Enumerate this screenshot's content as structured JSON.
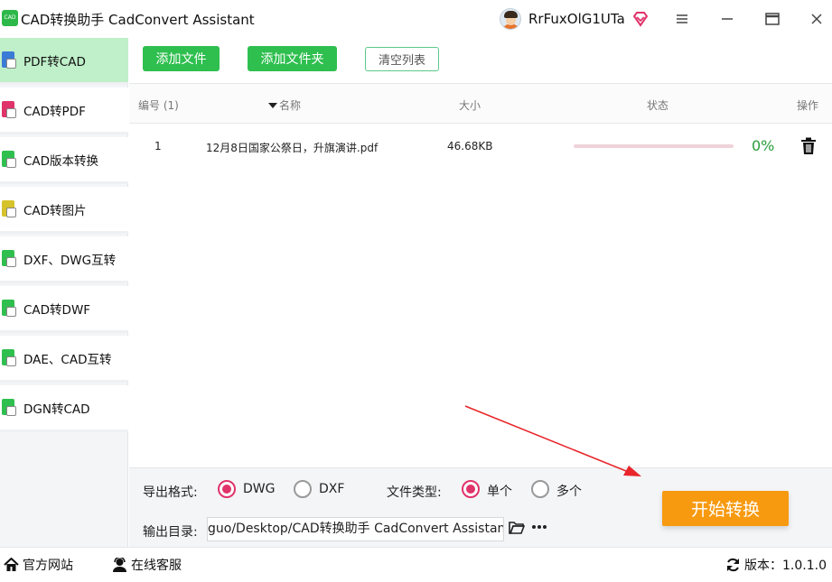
{
  "app": {
    "logo_text": "CAD",
    "title": "CAD转换助手 CadConvert Assistant",
    "username": "RrFuxOlG1UTa",
    "window_buttons": [
      "menu-icon",
      "minimize-icon",
      "maximize-icon",
      "close-icon"
    ]
  },
  "sidebar": {
    "items": [
      {
        "label": "PDF转CAD",
        "active": true,
        "icon": "pdf-to-cad-icon"
      },
      {
        "label": "CAD转PDF",
        "active": false,
        "icon": "cad-to-pdf-icon"
      },
      {
        "label": "CAD版本转换",
        "active": false,
        "icon": "cad-version-icon"
      },
      {
        "label": "CAD转图片",
        "active": false,
        "icon": "cad-to-image-icon"
      },
      {
        "label": "DXF、DWG互转",
        "active": false,
        "icon": "dxf-dwg-icon"
      },
      {
        "label": "CAD转DWF",
        "active": false,
        "icon": "cad-to-dwf-icon"
      },
      {
        "label": "DAE、CAD互转",
        "active": false,
        "icon": "dae-cad-icon"
      },
      {
        "label": "DGN转CAD",
        "active": false,
        "icon": "dgn-to-cad-icon"
      }
    ]
  },
  "toolbar": {
    "add_file": "添加文件",
    "add_folder": "添加文件夹",
    "clear_list": "清空列表"
  },
  "table": {
    "headers": {
      "index": "编号 (1)",
      "name": "名称",
      "size": "大小",
      "status": "状态",
      "action": "操作"
    },
    "rows": [
      {
        "index": "1",
        "name": "12月8日国家公祭日，升旗演讲.pdf",
        "size": "46.68KB",
        "progress": 0,
        "percent": "0%"
      }
    ]
  },
  "options": {
    "format_label": "导出格式:",
    "format_dwg": "DWG",
    "format_dxf": "DXF",
    "format_selected": "DWG",
    "type_label": "文件类型:",
    "type_single": "单个",
    "type_multi": "多个",
    "type_selected": "单个",
    "output_label": "输出目录:",
    "output_path": "guo/Desktop/CAD转换助手 CadConvert Assistant",
    "start_button": "开始转换"
  },
  "statusbar": {
    "website": "官方网站",
    "support": "在线客服",
    "version": "版本：1.0.1.0"
  },
  "colors": {
    "accent_green": "#2fbf4f",
    "active_bg": "#bff0c9",
    "radio_selected": "#e0336a",
    "start_orange": "#f79a10",
    "arrow_red": "#e8262b"
  }
}
